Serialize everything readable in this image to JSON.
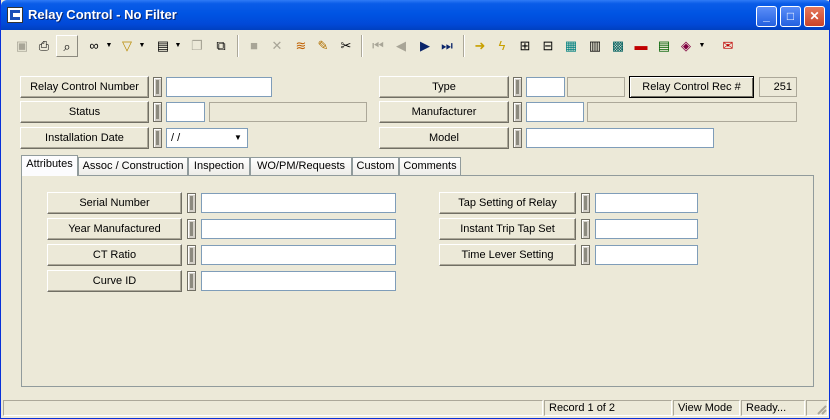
{
  "window": {
    "title": "Relay Control - No Filter",
    "min_label": "_",
    "max_label": "□",
    "close_label": "✕"
  },
  "toolbar": {
    "icons": [
      "save-icon",
      "print-icon",
      "preview-icon",
      "binoculars-icon",
      "filter-icon",
      "report-icon",
      "copy-icon",
      "paste-icon",
      "cancel-icon",
      "delete-icon",
      "stack-icon",
      "pencil-icon",
      "scissors-icon",
      "first-record-icon",
      "previous-record-icon",
      "next-record-icon",
      "last-record-icon",
      "arrow-right-icon",
      "lightning-icon",
      "tree-icon",
      "hierarchy-icon",
      "screen-icon",
      "calculator-icon",
      "grid-icon",
      "truck-icon",
      "chart-icon",
      "book-icon",
      "mail-icon"
    ]
  },
  "header": {
    "relay_control_number_label": "Relay Control Number",
    "relay_control_number_value": "",
    "status_label": "Status",
    "status_code": "",
    "status_desc": "",
    "installation_date_label": "Installation Date",
    "installation_date_value": " / /",
    "type_label": "Type",
    "type_code": "",
    "type_desc": "",
    "relay_control_rec_label": "Relay Control Rec #",
    "relay_control_rec_value": "251",
    "manufacturer_label": "Manufacturer",
    "manufacturer_code": "",
    "manufacturer_desc": "",
    "model_label": "Model",
    "model_value": ""
  },
  "tabs": [
    {
      "label": "Attributes"
    },
    {
      "label": "Assoc / Construction"
    },
    {
      "label": "Inspection"
    },
    {
      "label": "WO/PM/Requests"
    },
    {
      "label": "Custom"
    },
    {
      "label": "Comments"
    }
  ],
  "attributes": {
    "serial_number_label": "Serial Number",
    "year_manufactured_label": "Year Manufactured",
    "ct_ratio_label": "CT Ratio",
    "curve_id_label": "Curve ID",
    "tap_setting_label": "Tap Setting of Relay",
    "instant_trip_label": "Instant Trip Tap Set",
    "time_lever_label": "Time Lever Setting"
  },
  "status": {
    "record": "Record 1 of 2",
    "mode": "View Mode",
    "state": "Ready..."
  }
}
